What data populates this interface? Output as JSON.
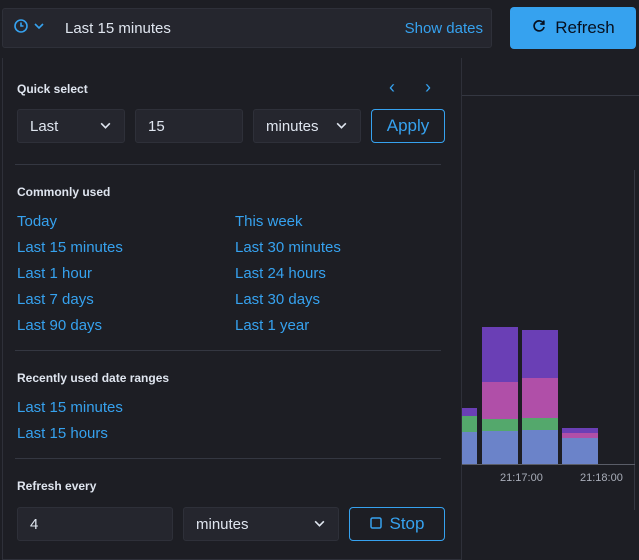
{
  "topbar": {
    "date_text": "Last 15 minutes",
    "show_dates": "Show dates",
    "refresh_label": "Refresh"
  },
  "quick_select": {
    "title": "Quick select",
    "direction": "Last",
    "amount": "15",
    "unit": "minutes",
    "apply_label": "Apply"
  },
  "commonly_used": {
    "title": "Commonly used",
    "left": [
      "Today",
      "Last 15 minutes",
      "Last 1 hour",
      "Last 7 days",
      "Last 90 days"
    ],
    "right": [
      "This week",
      "Last 30 minutes",
      "Last 24 hours",
      "Last 30 days",
      "Last 1 year"
    ]
  },
  "recently_used": {
    "title": "Recently used date ranges",
    "items": [
      "Last 15 minutes",
      "Last 15 hours"
    ]
  },
  "refresh_every": {
    "title": "Refresh every",
    "interval": "4",
    "unit": "minutes",
    "stop_label": "Stop"
  },
  "background_chart": {
    "xticks": [
      ")",
      "21:17:00",
      "21:18:00"
    ]
  },
  "colors": {
    "accent": "#36a2ef",
    "purple": "#6a3fb5",
    "magenta": "#b04fa8",
    "green": "#54a86c",
    "blue": "#6b83c9"
  }
}
